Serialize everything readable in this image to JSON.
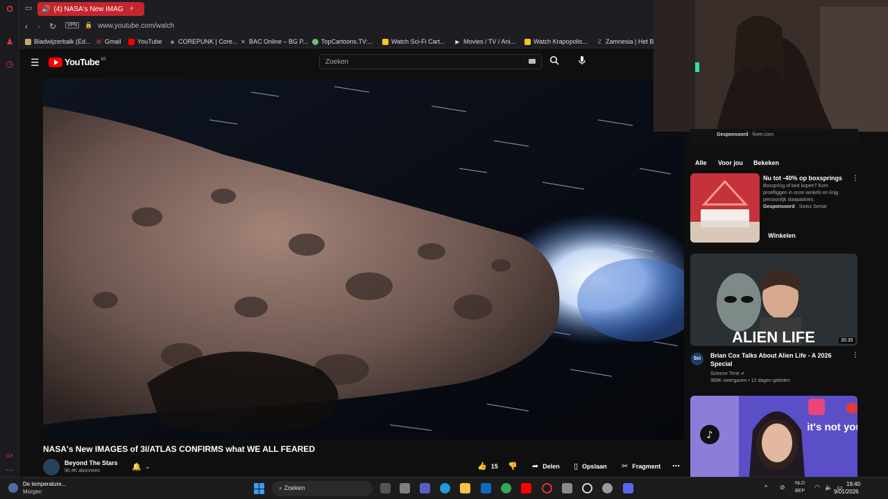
{
  "browser": {
    "tab_title": "(4) NASA's New IMAG",
    "new_tab": "+",
    "vpn": "VPN",
    "url": "www.youtube.com/watch",
    "bookmarks": [
      {
        "label": "Bladwijzerbalk (Ed...",
        "icon": "folder-icon",
        "color": "#c8a86b"
      },
      {
        "label": "Gmail",
        "icon": "gmail-icon",
        "color": "#ea4335"
      },
      {
        "label": "YouTube",
        "icon": "youtube-icon",
        "color": "#ff0000"
      },
      {
        "label": "COREPUNK | Core...",
        "icon": "corepunk-icon",
        "color": "#888888"
      },
      {
        "label": "BAC Online – BG P...",
        "icon": "bac-icon",
        "color": "#bbbbbb"
      },
      {
        "label": "TopCartoons.TV:...",
        "icon": "topcartoons-icon",
        "color": "#6fbf73"
      },
      {
        "label": "Watch Sci-Fi Cart...",
        "icon": "scifi-icon",
        "color": "#f3c623"
      },
      {
        "label": "Movies / TV / Ani...",
        "icon": "play-icon",
        "color": "#dddddd"
      },
      {
        "label": "Watch Krapopolis...",
        "icon": "krapopolis-icon",
        "color": "#f3c623"
      },
      {
        "label": "Zamnesia | Het Be",
        "icon": "zamnesia-icon",
        "color": "#5bbf8a"
      }
    ]
  },
  "youtube": {
    "logo": "YouTube",
    "logo_country": "BE",
    "search_placeholder": "Zoeken",
    "video_title": "NASA's New IMAGES of 3I/ATLAS CONFIRMS what WE ALL FEARED",
    "channel_name": "Beyond The Stars",
    "channel_subs": "90,4K abonnees",
    "likes": "15",
    "share": "Delen",
    "save": "Opslaan",
    "clip": "Fragment"
  },
  "sidebar": {
    "top_sponsored_label": "Gesponsoord",
    "top_sponsored_domain": " · fiverr.com",
    "chips": [
      "Alle",
      "Voor jou",
      "Bekeken"
    ],
    "ad": {
      "title": "Nu tot -40% op boxsprings",
      "description": "Boxspring of bed kopen? Kom proefliggen in onze winkels en krijg persoonlijk slaapadvies.",
      "sponsored_label": "Gesponsoord",
      "sponsor": " · Swiss Sense",
      "cta": "Winkelen"
    },
    "recommendations": [
      {
        "title": "Brian Cox Talks About Alien Life - A 2026 Special",
        "channel": "Science Time",
        "meta": "389K weergaven • 12 dagen geleden",
        "duration": "35:35",
        "thumb_text": "ALIEN LIFE",
        "avatar_text": "Sci"
      },
      {
        "thumb_text": "it's not you."
      }
    ]
  },
  "taskbar": {
    "weather_title": "De temperature...",
    "weather_sub": "Morgen",
    "search": "Zoeken",
    "lang1": "NLD",
    "lang2": "BEP",
    "time": "19:40",
    "date": "9/01/2026"
  },
  "colors": {
    "opera_red": "#c4262e",
    "youtube_red": "#ff0000",
    "bg": "#0f0f0f"
  }
}
